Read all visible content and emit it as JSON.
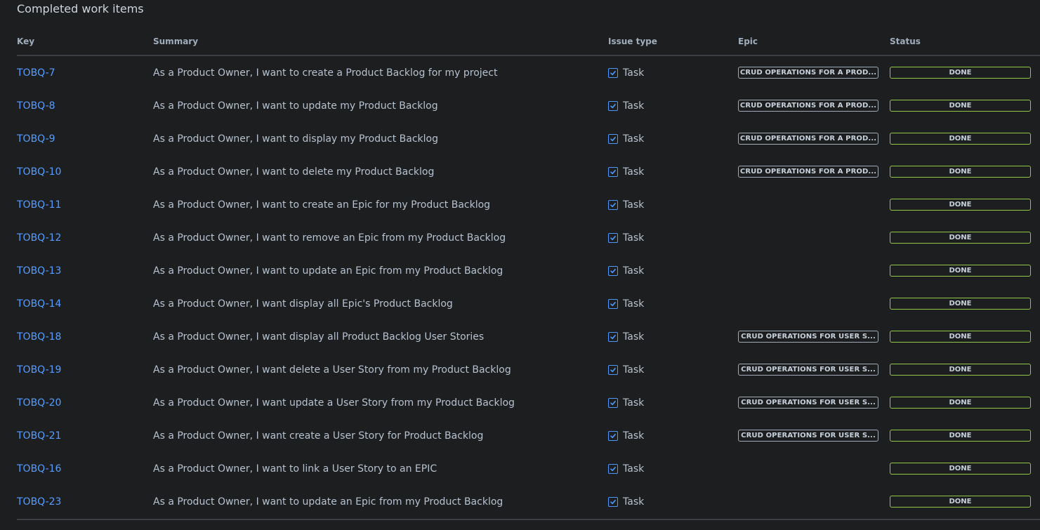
{
  "section_title": "Completed work items",
  "columns": {
    "key": "Key",
    "summary": "Summary",
    "issue_type": "Issue type",
    "epic": "Epic",
    "status": "Status"
  },
  "rows": [
    {
      "key": "TOBQ-7",
      "summary": "As a Product Owner, I want to create a Product Backlog for my project",
      "type": "Task",
      "epic": "CRUD OPERATIONS FOR A PROD...",
      "status": "DONE"
    },
    {
      "key": "TOBQ-8",
      "summary": "As a Product Owner, I want to update my Product Backlog",
      "type": "Task",
      "epic": "CRUD OPERATIONS FOR A PROD...",
      "status": "DONE"
    },
    {
      "key": "TOBQ-9",
      "summary": "As a Product Owner, I want to display my Product Backlog",
      "type": "Task",
      "epic": "CRUD OPERATIONS FOR A PROD...",
      "status": "DONE"
    },
    {
      "key": "TOBQ-10",
      "summary": "As a Product Owner, I want to delete my Product Backlog",
      "type": "Task",
      "epic": "CRUD OPERATIONS FOR A PROD...",
      "status": "DONE"
    },
    {
      "key": "TOBQ-11",
      "summary": "As a Product Owner, I want to create an Epic for my Product Backlog",
      "type": "Task",
      "epic": "",
      "status": "DONE"
    },
    {
      "key": "TOBQ-12",
      "summary": "As a Product Owner, I want to remove an Epic from my Product Backlog",
      "type": "Task",
      "epic": "",
      "status": "DONE"
    },
    {
      "key": "TOBQ-13",
      "summary": "As a Product Owner, I want to update an Epic from my Product Backlog",
      "type": "Task",
      "epic": "",
      "status": "DONE"
    },
    {
      "key": "TOBQ-14",
      "summary": "As a Product Owner, I want display all Epic's Product Backlog",
      "type": "Task",
      "epic": "",
      "status": "DONE"
    },
    {
      "key": "TOBQ-18",
      "summary": "As a Product Owner, I want display all Product Backlog User Stories",
      "type": "Task",
      "epic": "CRUD OPERATIONS FOR USER S...",
      "status": "DONE"
    },
    {
      "key": "TOBQ-19",
      "summary": "As a Product Owner, I want delete a User Story from my Product Backlog",
      "type": "Task",
      "epic": "CRUD OPERATIONS FOR USER S...",
      "status": "DONE"
    },
    {
      "key": "TOBQ-20",
      "summary": "As a Product Owner, I want update a User Story from my Product Backlog",
      "type": "Task",
      "epic": "CRUD OPERATIONS FOR USER S...",
      "status": "DONE"
    },
    {
      "key": "TOBQ-21",
      "summary": "As a Product Owner, I want create a User Story for Product Backlog",
      "type": "Task",
      "epic": "CRUD OPERATIONS FOR USER S...",
      "status": "DONE"
    },
    {
      "key": "TOBQ-16",
      "summary": "As a Product Owner, I want to link a User Story to an EPIC",
      "type": "Task",
      "epic": "",
      "status": "DONE"
    },
    {
      "key": "TOBQ-23",
      "summary": "As a Product Owner, I want to update an Epic from my Product Backlog",
      "type": "Task",
      "epic": "",
      "status": "DONE"
    }
  ],
  "icons": {
    "task": "task-checkbox-icon"
  },
  "colors": {
    "background": "#1d1e20",
    "link": "#579dff",
    "task_icon": "#4c9aff",
    "status_done_border": "#94c748",
    "epic_border": "#a1acb8"
  }
}
